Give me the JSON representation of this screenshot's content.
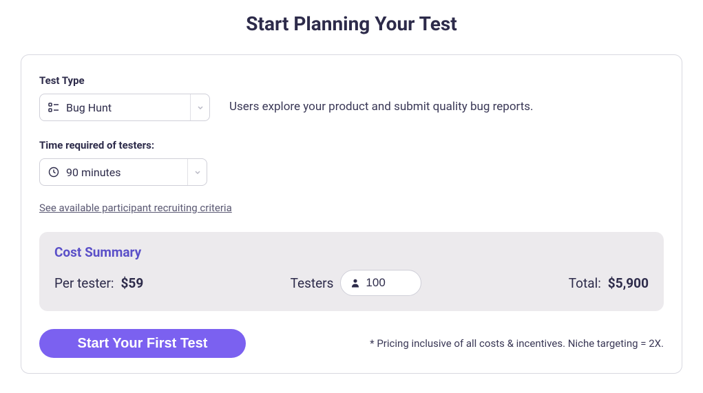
{
  "title": "Start Planning Your Test",
  "testType": {
    "label": "Test Type",
    "selected": "Bug Hunt",
    "description": "Users explore your product and submit quality bug reports."
  },
  "time": {
    "label": "Time required of testers:",
    "selected": "90 minutes"
  },
  "recruitingLink": "See available participant recruiting criteria",
  "cost": {
    "title": "Cost Summary",
    "perTesterLabel": "Per tester:",
    "perTesterValue": "$59",
    "testersLabel": "Testers",
    "testersValue": "100",
    "totalLabel": "Total:",
    "totalValue": "$5,900"
  },
  "cta": "Start Your First Test",
  "disclaimer": "* Pricing inclusive of all costs & incentives. Niche targeting = 2X."
}
